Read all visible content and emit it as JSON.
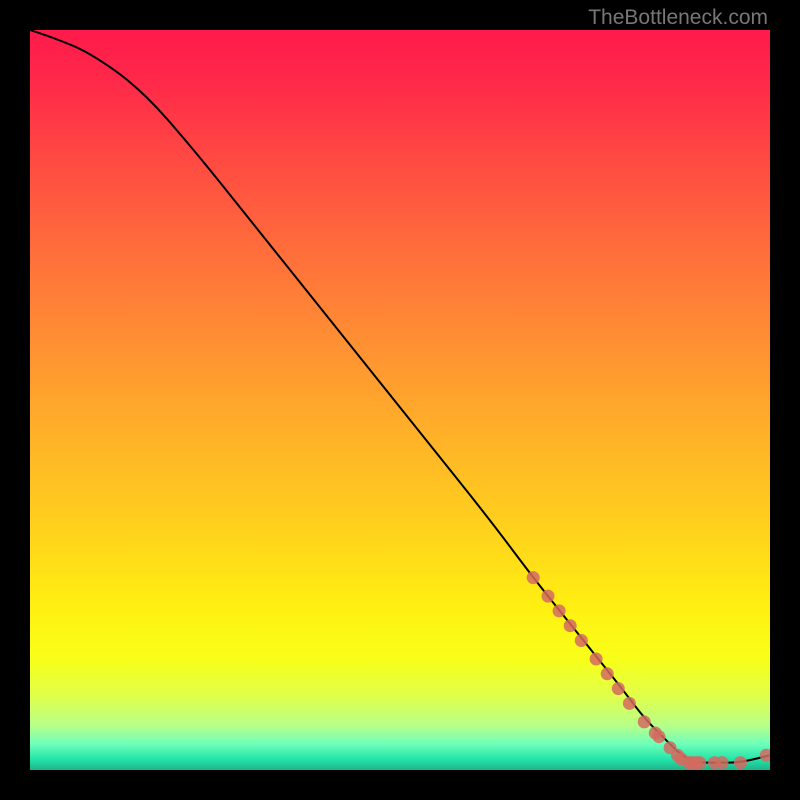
{
  "watermark": "TheBottleneck.com",
  "chart_data": {
    "type": "line",
    "title": "",
    "xlabel": "",
    "ylabel": "",
    "xlim": [
      0,
      100
    ],
    "ylim": [
      0,
      100
    ],
    "series": [
      {
        "name": "curve",
        "x": [
          0,
          3,
          8,
          15,
          22,
          30,
          38,
          46,
          54,
          62,
          68,
          72,
          76,
          80,
          83,
          86,
          88,
          90,
          93,
          96,
          100
        ],
        "y": [
          100,
          99,
          97,
          92,
          84,
          74,
          64,
          54,
          44,
          34,
          26,
          21,
          16,
          11,
          7,
          4,
          2,
          1,
          1,
          1,
          2
        ]
      }
    ],
    "highlight_points": {
      "name": "markers",
      "x": [
        68,
        70,
        71.5,
        73,
        74.5,
        76.5,
        78,
        79.5,
        81,
        83,
        84.5,
        85,
        86.5,
        87.5,
        88,
        89,
        89.5,
        90,
        90.5,
        92.5,
        93.5,
        96,
        99.5
      ],
      "y": [
        26,
        23.5,
        21.5,
        19.5,
        17.5,
        15,
        13,
        11,
        9,
        6.5,
        5,
        4.5,
        3,
        2,
        1.5,
        1,
        1,
        1,
        1,
        1,
        1,
        1,
        2
      ]
    },
    "gradient_stops": [
      {
        "offset": 0.0,
        "color": "#ff1a4b"
      },
      {
        "offset": 0.07,
        "color": "#ff2949"
      },
      {
        "offset": 0.18,
        "color": "#ff4b42"
      },
      {
        "offset": 0.3,
        "color": "#ff6e3b"
      },
      {
        "offset": 0.42,
        "color": "#ff8f33"
      },
      {
        "offset": 0.55,
        "color": "#ffb228"
      },
      {
        "offset": 0.68,
        "color": "#ffd31c"
      },
      {
        "offset": 0.78,
        "color": "#fff011"
      },
      {
        "offset": 0.85,
        "color": "#f8ff19"
      },
      {
        "offset": 0.9,
        "color": "#e0ff4a"
      },
      {
        "offset": 0.94,
        "color": "#b7ff8a"
      },
      {
        "offset": 0.965,
        "color": "#6effba"
      },
      {
        "offset": 0.985,
        "color": "#24e5a9"
      },
      {
        "offset": 1.0,
        "color": "#1fb48a"
      }
    ]
  }
}
